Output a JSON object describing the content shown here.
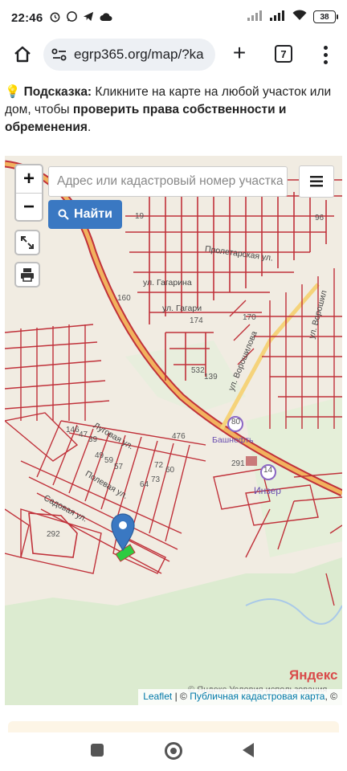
{
  "status_bar": {
    "time": "22:46",
    "battery": "38",
    "left_icons": [
      "alarm-icon",
      "whatsapp-icon",
      "telegram-icon",
      "cloud-icon"
    ],
    "right_icons": [
      "signal-icon",
      "signal-icon",
      "wifi-icon",
      "battery-icon"
    ]
  },
  "browser": {
    "url": "egrp365.org/map/?ka",
    "tab_count": "7",
    "new_tab_label": "+"
  },
  "hint": {
    "emoji": "💡",
    "label": "Подсказка:",
    "text_part1": " Кликните на карте на любой участок или дом, чтобы ",
    "bold_part": "проверить права собственности и обременения",
    "text_part2": "."
  },
  "map": {
    "zoom_in": "+",
    "zoom_out": "−",
    "search_placeholder": "Адрес или кадастровый номер участка",
    "find_button": "Найти",
    "layers_icon": "menu-icon",
    "fullscreen_icon": "fullscreen-icon",
    "print_icon": "print-icon",
    "attribution": {
      "leaflet": "Leaflet",
      "sep": " | © ",
      "cadastral": "Публичная кадастровая карта",
      "tail": ", ©"
    },
    "yandex": "Яндекс",
    "yandex_terms": "© Яндекс  Условия использования",
    "streets": [
      "ул. Гагарина",
      "ул. Гагари",
      "ул. Ворошилова",
      "ул. Ворошил",
      "Луговая ул.",
      "Полевая ул.",
      "Пролетарская ул.",
      "Садовая ул.",
      "Башнефть",
      "Инзер"
    ],
    "plot_numbers": [
      "19",
      "90",
      "96",
      "160",
      "174",
      "170",
      "532",
      "139",
      "476",
      "291",
      "292",
      "146",
      "47",
      "39",
      "49",
      "59",
      "57",
      "64",
      "73",
      "72",
      "60",
      "80",
      "14"
    ]
  },
  "colors": {
    "parcel_stroke": "#c0313a",
    "road": "#e8922e",
    "forest": "#dcebd0",
    "background": "#f1ece2",
    "button_blue": "#3a78c2",
    "marker": "#3a78c2",
    "selected_parcel": "#2ecc40"
  }
}
